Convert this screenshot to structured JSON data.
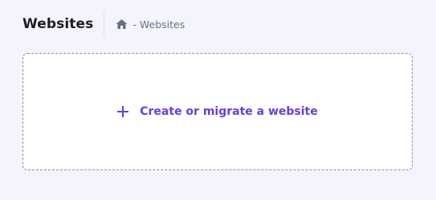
{
  "header": {
    "title": "Websites",
    "breadcrumb": {
      "home_icon": "home-icon",
      "separator": "-",
      "current": "Websites"
    }
  },
  "create_card": {
    "icon": "plus-icon",
    "label": "Create or migrate a website"
  },
  "colors": {
    "background": "#f4f4fe",
    "accent": "#673de6",
    "card_border": "#8f80c8",
    "title": "#1d1e20",
    "muted": "#6d7081"
  }
}
